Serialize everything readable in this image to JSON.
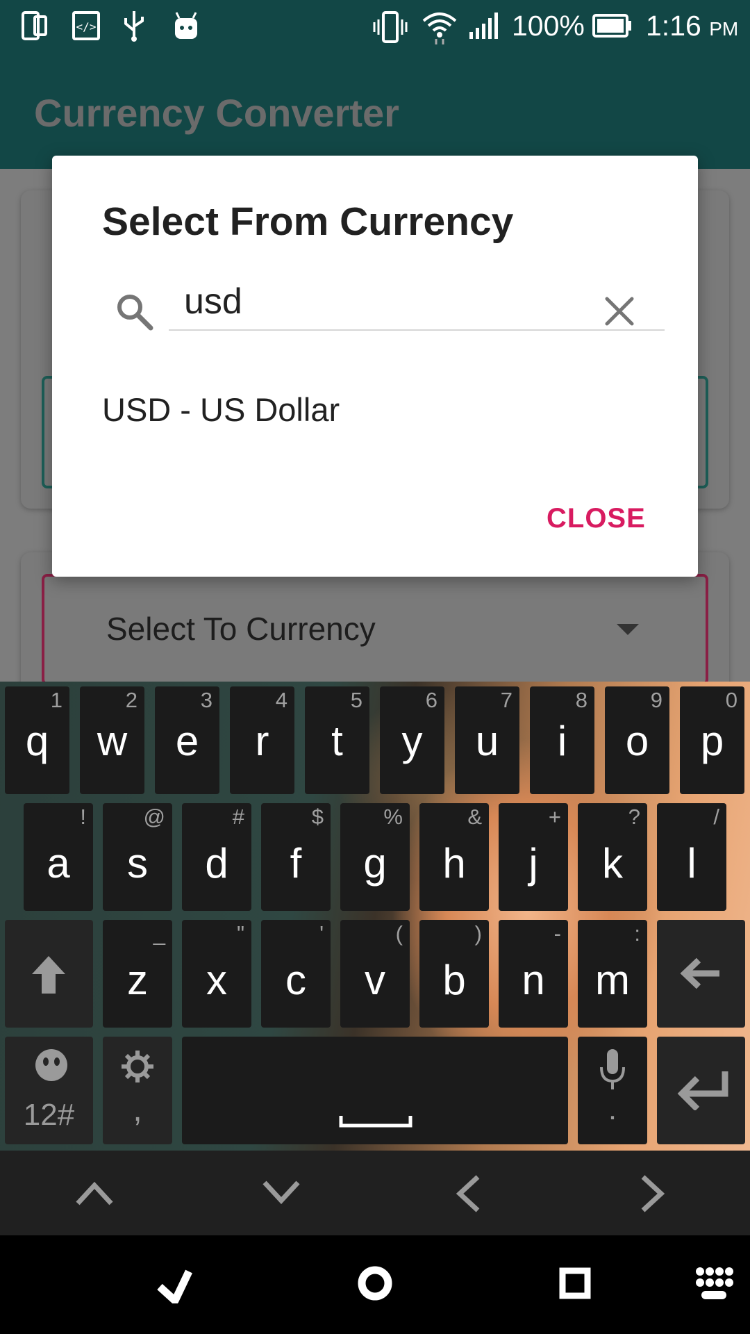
{
  "status_bar": {
    "battery": "100%",
    "time": "1:16",
    "ampm": "PM",
    "icons": [
      "device-icon",
      "code-icon",
      "usb-icon",
      "android-icon",
      "vibrate-icon",
      "wifi-icon",
      "signal-icon",
      "battery-icon"
    ]
  },
  "app": {
    "title": "Currency Converter"
  },
  "background": {
    "to_currency_placeholder": "Select To Currency"
  },
  "dialog": {
    "title": "Select From Currency",
    "search_value": "usd",
    "results": [
      "USD - US Dollar"
    ],
    "close_label": "CLOSE"
  },
  "keyboard": {
    "row1": [
      {
        "key": "q",
        "hint": "1"
      },
      {
        "key": "w",
        "hint": "2"
      },
      {
        "key": "e",
        "hint": "3"
      },
      {
        "key": "r",
        "hint": "4"
      },
      {
        "key": "t",
        "hint": "5"
      },
      {
        "key": "y",
        "hint": "6"
      },
      {
        "key": "u",
        "hint": "7"
      },
      {
        "key": "i",
        "hint": "8"
      },
      {
        "key": "o",
        "hint": "9"
      },
      {
        "key": "p",
        "hint": "0"
      }
    ],
    "row2": [
      {
        "key": "a",
        "hint": "!"
      },
      {
        "key": "s",
        "hint": "@"
      },
      {
        "key": "d",
        "hint": "#"
      },
      {
        "key": "f",
        "hint": "$"
      },
      {
        "key": "g",
        "hint": "%"
      },
      {
        "key": "h",
        "hint": "&"
      },
      {
        "key": "j",
        "hint": "+"
      },
      {
        "key": "k",
        "hint": "?"
      },
      {
        "key": "l",
        "hint": "/"
      }
    ],
    "row3": [
      {
        "key": "z",
        "hint": "_"
      },
      {
        "key": "x",
        "hint": "\""
      },
      {
        "key": "c",
        "hint": "'"
      },
      {
        "key": "v",
        "hint": "("
      },
      {
        "key": "b",
        "hint": ")"
      },
      {
        "key": "n",
        "hint": "-"
      },
      {
        "key": "m",
        "hint": ":"
      }
    ],
    "symbols_label": "12#",
    "comma_label": ",",
    "period_label": "."
  },
  "colors": {
    "primary": "#124746",
    "accent": "#d81b60",
    "from_outline": "#1d5f58",
    "to_outline": "#8a1f45"
  }
}
